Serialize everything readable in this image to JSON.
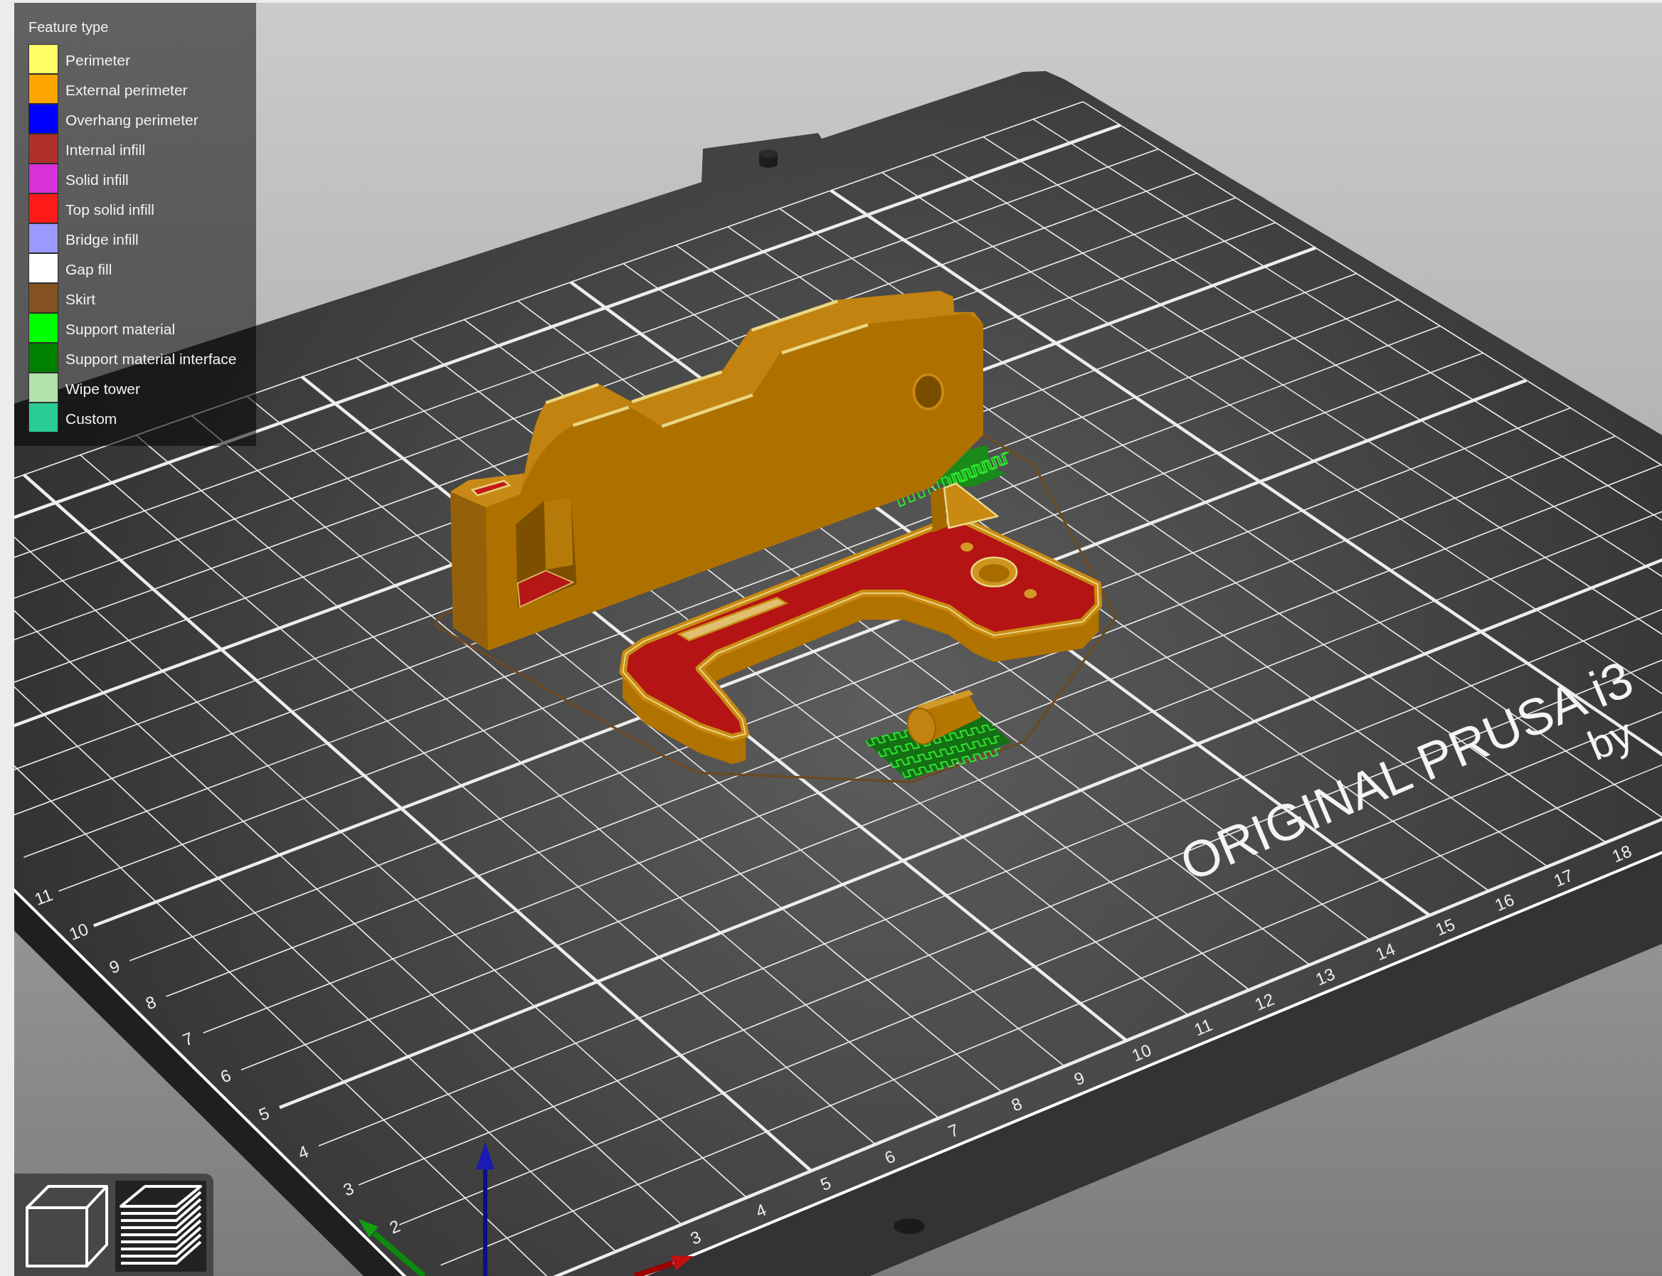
{
  "legend": {
    "title": "Feature type",
    "items": [
      {
        "label": "Perimeter",
        "color": "#ffff66"
      },
      {
        "label": "External perimeter",
        "color": "#ffa500"
      },
      {
        "label": "Overhang perimeter",
        "color": "#0000ff"
      },
      {
        "label": "Internal infill",
        "color": "#b1302a"
      },
      {
        "label": "Solid infill",
        "color": "#d732d7"
      },
      {
        "label": "Top solid infill",
        "color": "#ff1a1a"
      },
      {
        "label": "Bridge infill",
        "color": "#9999ff"
      },
      {
        "label": "Gap fill",
        "color": "#ffffff"
      },
      {
        "label": "Skirt",
        "color": "#845321"
      },
      {
        "label": "Support material",
        "color": "#00ff00"
      },
      {
        "label": "Support material interface",
        "color": "#008000"
      },
      {
        "label": "Wipe tower",
        "color": "#b3e3ab"
      },
      {
        "label": "Custom",
        "color": "#28cc94"
      }
    ]
  },
  "bed": {
    "logo_text": "ORIGINAL PRUSA i3",
    "logo_subtext": "by",
    "x_axis_labels": [
      "3",
      "4",
      "5",
      "6",
      "7",
      "8",
      "9",
      "10",
      "11",
      "12",
      "13",
      "14",
      "15",
      "16",
      "17",
      "18"
    ],
    "y_axis_labels": [
      "2",
      "3",
      "4",
      "5",
      "6",
      "7",
      "8",
      "9",
      "10",
      "11"
    ]
  },
  "view_toolbar": {
    "buttons": [
      {
        "kind": "model",
        "selected": false
      },
      {
        "kind": "preview",
        "selected": true
      }
    ]
  }
}
